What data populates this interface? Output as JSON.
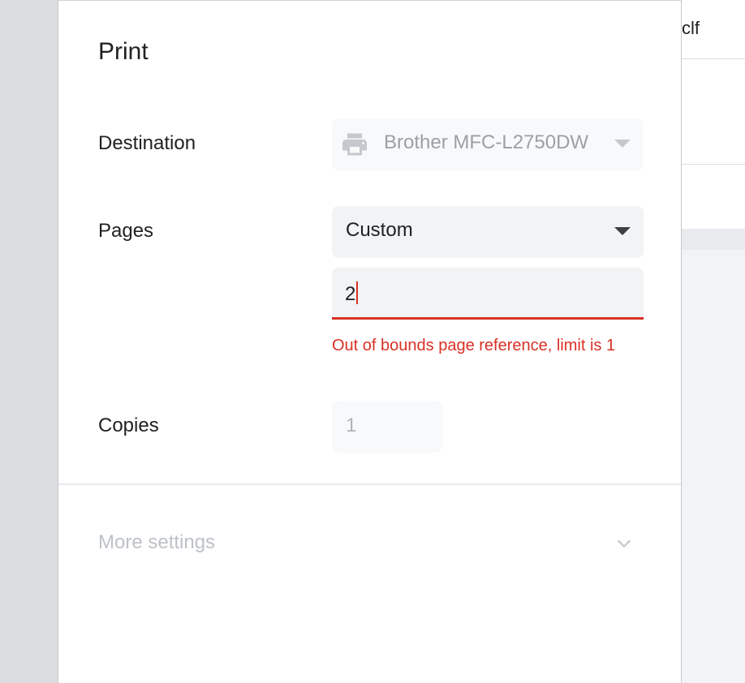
{
  "background": {
    "snippet_text": "clf"
  },
  "dialog": {
    "title": "Print",
    "destination": {
      "label": "Destination",
      "value": "Brother MFC-L2750DW",
      "icon": "printer-icon"
    },
    "pages": {
      "label": "Pages",
      "value": "Custom",
      "custom_input_value": "2",
      "error": "Out of bounds page reference, limit is 1"
    },
    "copies": {
      "label": "Copies",
      "value": "1"
    },
    "more_settings": {
      "label": "More settings",
      "icon": "chevron-down-icon"
    }
  },
  "colors": {
    "error": "#d93025",
    "field_bg": "#f1f3f4",
    "side_strip": "#dcdde1"
  }
}
